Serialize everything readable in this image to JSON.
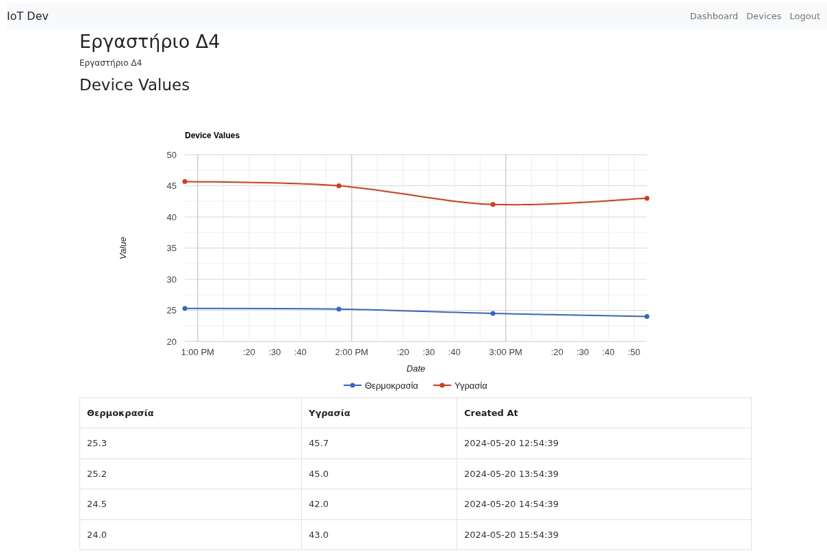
{
  "navbar": {
    "brand": "IoT Dev",
    "links": [
      "Dashboard",
      "Devices",
      "Logout"
    ]
  },
  "page": {
    "title": "Εργαστήριο Δ4",
    "subtitle": "Εργαστήριο Δ4",
    "section_title": "Device Values"
  },
  "chart": {
    "chart_data": {
      "type": "line",
      "title": "Device Values",
      "xlabel": "Date",
      "ylabel": "Value",
      "categories": [
        null,
        "1:00 PM",
        null,
        null,
        null,
        ":20",
        null,
        ":30",
        null,
        ":40",
        null,
        null,
        null,
        "2:00 PM",
        null,
        null,
        null,
        ":20",
        null,
        ":30",
        null,
        ":40",
        null,
        null,
        null,
        "3:00 PM",
        null,
        null,
        null,
        ":20",
        null,
        ":30",
        null,
        ":40",
        null,
        ":50",
        null
      ],
      "series": [
        {
          "name": "Θερμοκρασία",
          "color": "#3366cc",
          "marker": "circle",
          "values": [
            25.3,
            null,
            null,
            null,
            null,
            null,
            null,
            null,
            null,
            null,
            null,
            null,
            25.2,
            null,
            null,
            null,
            null,
            null,
            null,
            null,
            null,
            null,
            null,
            null,
            24.5,
            null,
            null,
            null,
            null,
            null,
            null,
            null,
            null,
            null,
            null,
            null,
            24.0
          ]
        },
        {
          "name": "Υγρασία",
          "color": "#dc3912",
          "marker": "circle",
          "values": [
            45.7,
            null,
            null,
            null,
            null,
            null,
            null,
            null,
            null,
            null,
            null,
            null,
            45.0,
            null,
            null,
            null,
            null,
            null,
            null,
            null,
            null,
            null,
            null,
            null,
            42.0,
            null,
            null,
            null,
            null,
            null,
            null,
            null,
            null,
            null,
            null,
            null,
            43.0
          ]
        }
      ],
      "ylim": [
        20,
        50
      ],
      "grid": true,
      "legend": "bottom",
      "yticks": [
        20,
        25,
        30,
        35,
        40,
        45,
        50
      ]
    }
  },
  "table": {
    "columns": [
      "Θερμοκρασία",
      "Υγρασία",
      "Created At"
    ],
    "rows": [
      [
        "25.3",
        "45.7",
        "2024-05-20 12:54:39"
      ],
      [
        "25.2",
        "45.0",
        "2024-05-20 13:54:39"
      ],
      [
        "24.5",
        "42.0",
        "2024-05-20 14:54:39"
      ],
      [
        "24.0",
        "43.0",
        "2024-05-20 15:54:39"
      ]
    ]
  }
}
